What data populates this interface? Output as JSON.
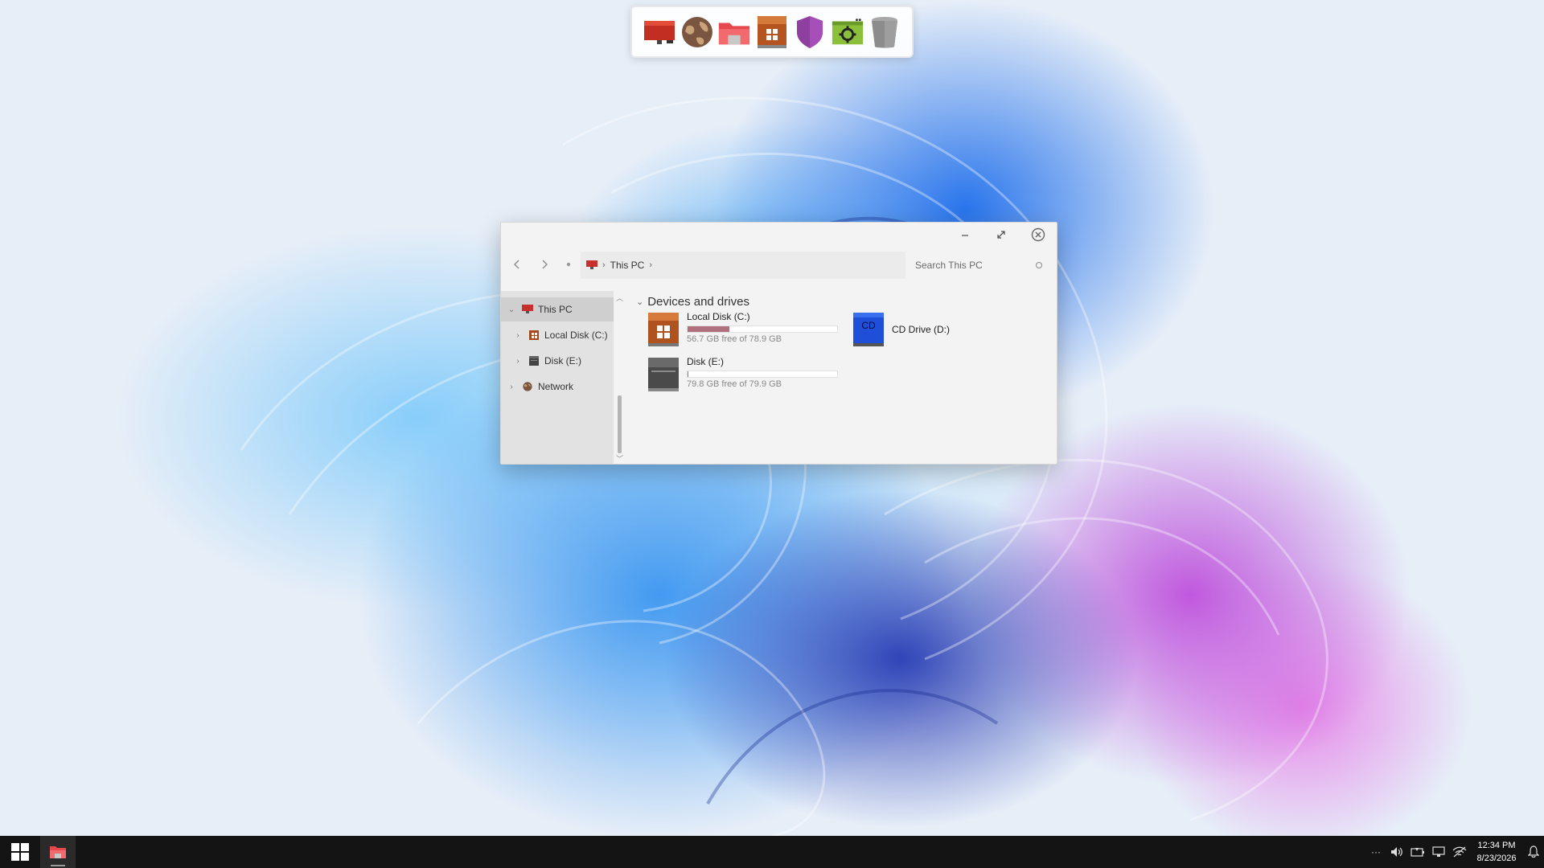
{
  "dock": {
    "items": [
      {
        "name": "desktop",
        "icon": "monitor-icon"
      },
      {
        "name": "network",
        "icon": "globe-icon"
      },
      {
        "name": "file-explorer",
        "icon": "folder-icon"
      },
      {
        "name": "windows-drive",
        "icon": "windows-drive-icon"
      },
      {
        "name": "security",
        "icon": "shield-icon"
      },
      {
        "name": "settings",
        "icon": "gear-icon"
      },
      {
        "name": "recycle-bin",
        "icon": "trash-icon"
      }
    ]
  },
  "explorer": {
    "address": {
      "location": "This PC"
    },
    "search": {
      "placeholder": "Search This PC"
    },
    "sidebar": {
      "items": [
        {
          "label": "This PC",
          "icon": "computer-icon",
          "selected": true,
          "expanded": true
        },
        {
          "label": "Local Disk (C:)",
          "icon": "windows-drive-icon"
        },
        {
          "label": "Disk (E:)",
          "icon": "drive-icon"
        },
        {
          "label": "Network",
          "icon": "globe-icon"
        }
      ]
    },
    "group_title": "Devices and drives",
    "drives": [
      {
        "name": "Local Disk (C:)",
        "free": "56.7 GB free of 78.9 GB",
        "used_fraction": 0.28,
        "icon": "windows-drive-icon"
      },
      {
        "name": "Disk (E:)",
        "free": "79.8 GB free of 79.9 GB",
        "used_fraction": 0.001,
        "icon": "drive-icon"
      },
      {
        "name": "CD Drive (D:)",
        "icon": "cd-drive-icon",
        "icon_text": "CD"
      }
    ]
  },
  "taskbar": {
    "clock": {
      "time": "12:34 PM",
      "date": "8/23/2026"
    },
    "tray": {
      "overflow": "···"
    }
  },
  "colors": {
    "accent_red": "#d83b3b",
    "usage_bar": "#b0707e",
    "taskbar_bg": "#141414"
  }
}
